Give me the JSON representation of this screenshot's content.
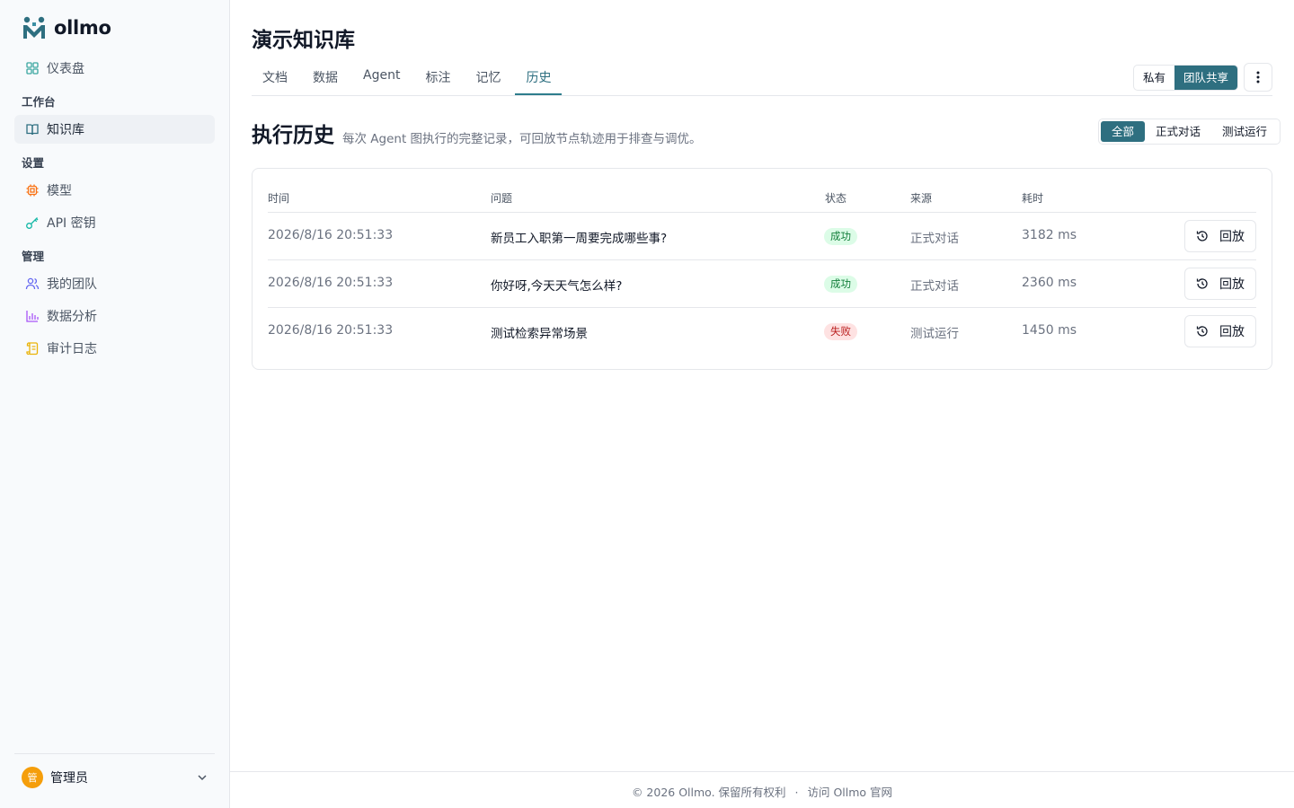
{
  "brand": {
    "name": "ollmo"
  },
  "sidebar": {
    "dashboard": "仪表盘",
    "groups": {
      "workspace": "工作台",
      "settings": "设置",
      "admin": "管理"
    },
    "knowledge": "知识库",
    "models": "模型",
    "api_keys": "API 密钥",
    "team": "我的团队",
    "analytics": "数据分析",
    "audit": "审计日志",
    "user": {
      "avatar": "管",
      "name": "管理员"
    }
  },
  "page": {
    "title": "演示知识库",
    "tabs": [
      "文档",
      "数据",
      "Agent",
      "标注",
      "记忆",
      "历史"
    ],
    "active_tab": "历史",
    "visibility": {
      "private": "私有",
      "team": "团队共享",
      "selected": "团队共享"
    }
  },
  "history": {
    "title": "执行历史",
    "description": "每次 Agent 图执行的完整记录，可回放节点轨迹用于排查与调优。",
    "filters": [
      "全部",
      "正式对话",
      "测试运行"
    ],
    "active_filter": "全部",
    "columns": {
      "time": "时间",
      "question": "问题",
      "status": "状态",
      "source": "来源",
      "duration": "耗时"
    },
    "replay_label": "回放",
    "rows": [
      {
        "time": "2026/8/16 20:51:33",
        "question": "新员工入职第一周要完成哪些事?",
        "status": "成功",
        "source": "正式对话",
        "duration": "3182 ms"
      },
      {
        "time": "2026/8/16 20:51:33",
        "question": "你好呀,今天天气怎么样?",
        "status": "成功",
        "source": "正式对话",
        "duration": "2360 ms"
      },
      {
        "time": "2026/8/16 20:51:33",
        "question": "测试检索异常场景",
        "status": "失败",
        "source": "测试运行",
        "duration": "1450 ms"
      }
    ]
  },
  "footer": {
    "copyright": "© 2026 Ollmo. 保留所有权利",
    "separator": "·",
    "link": "访问 Ollmo 官网"
  },
  "colors": {
    "accent": "#2e6f80",
    "success": "#15803d",
    "danger": "#b91c1c"
  }
}
